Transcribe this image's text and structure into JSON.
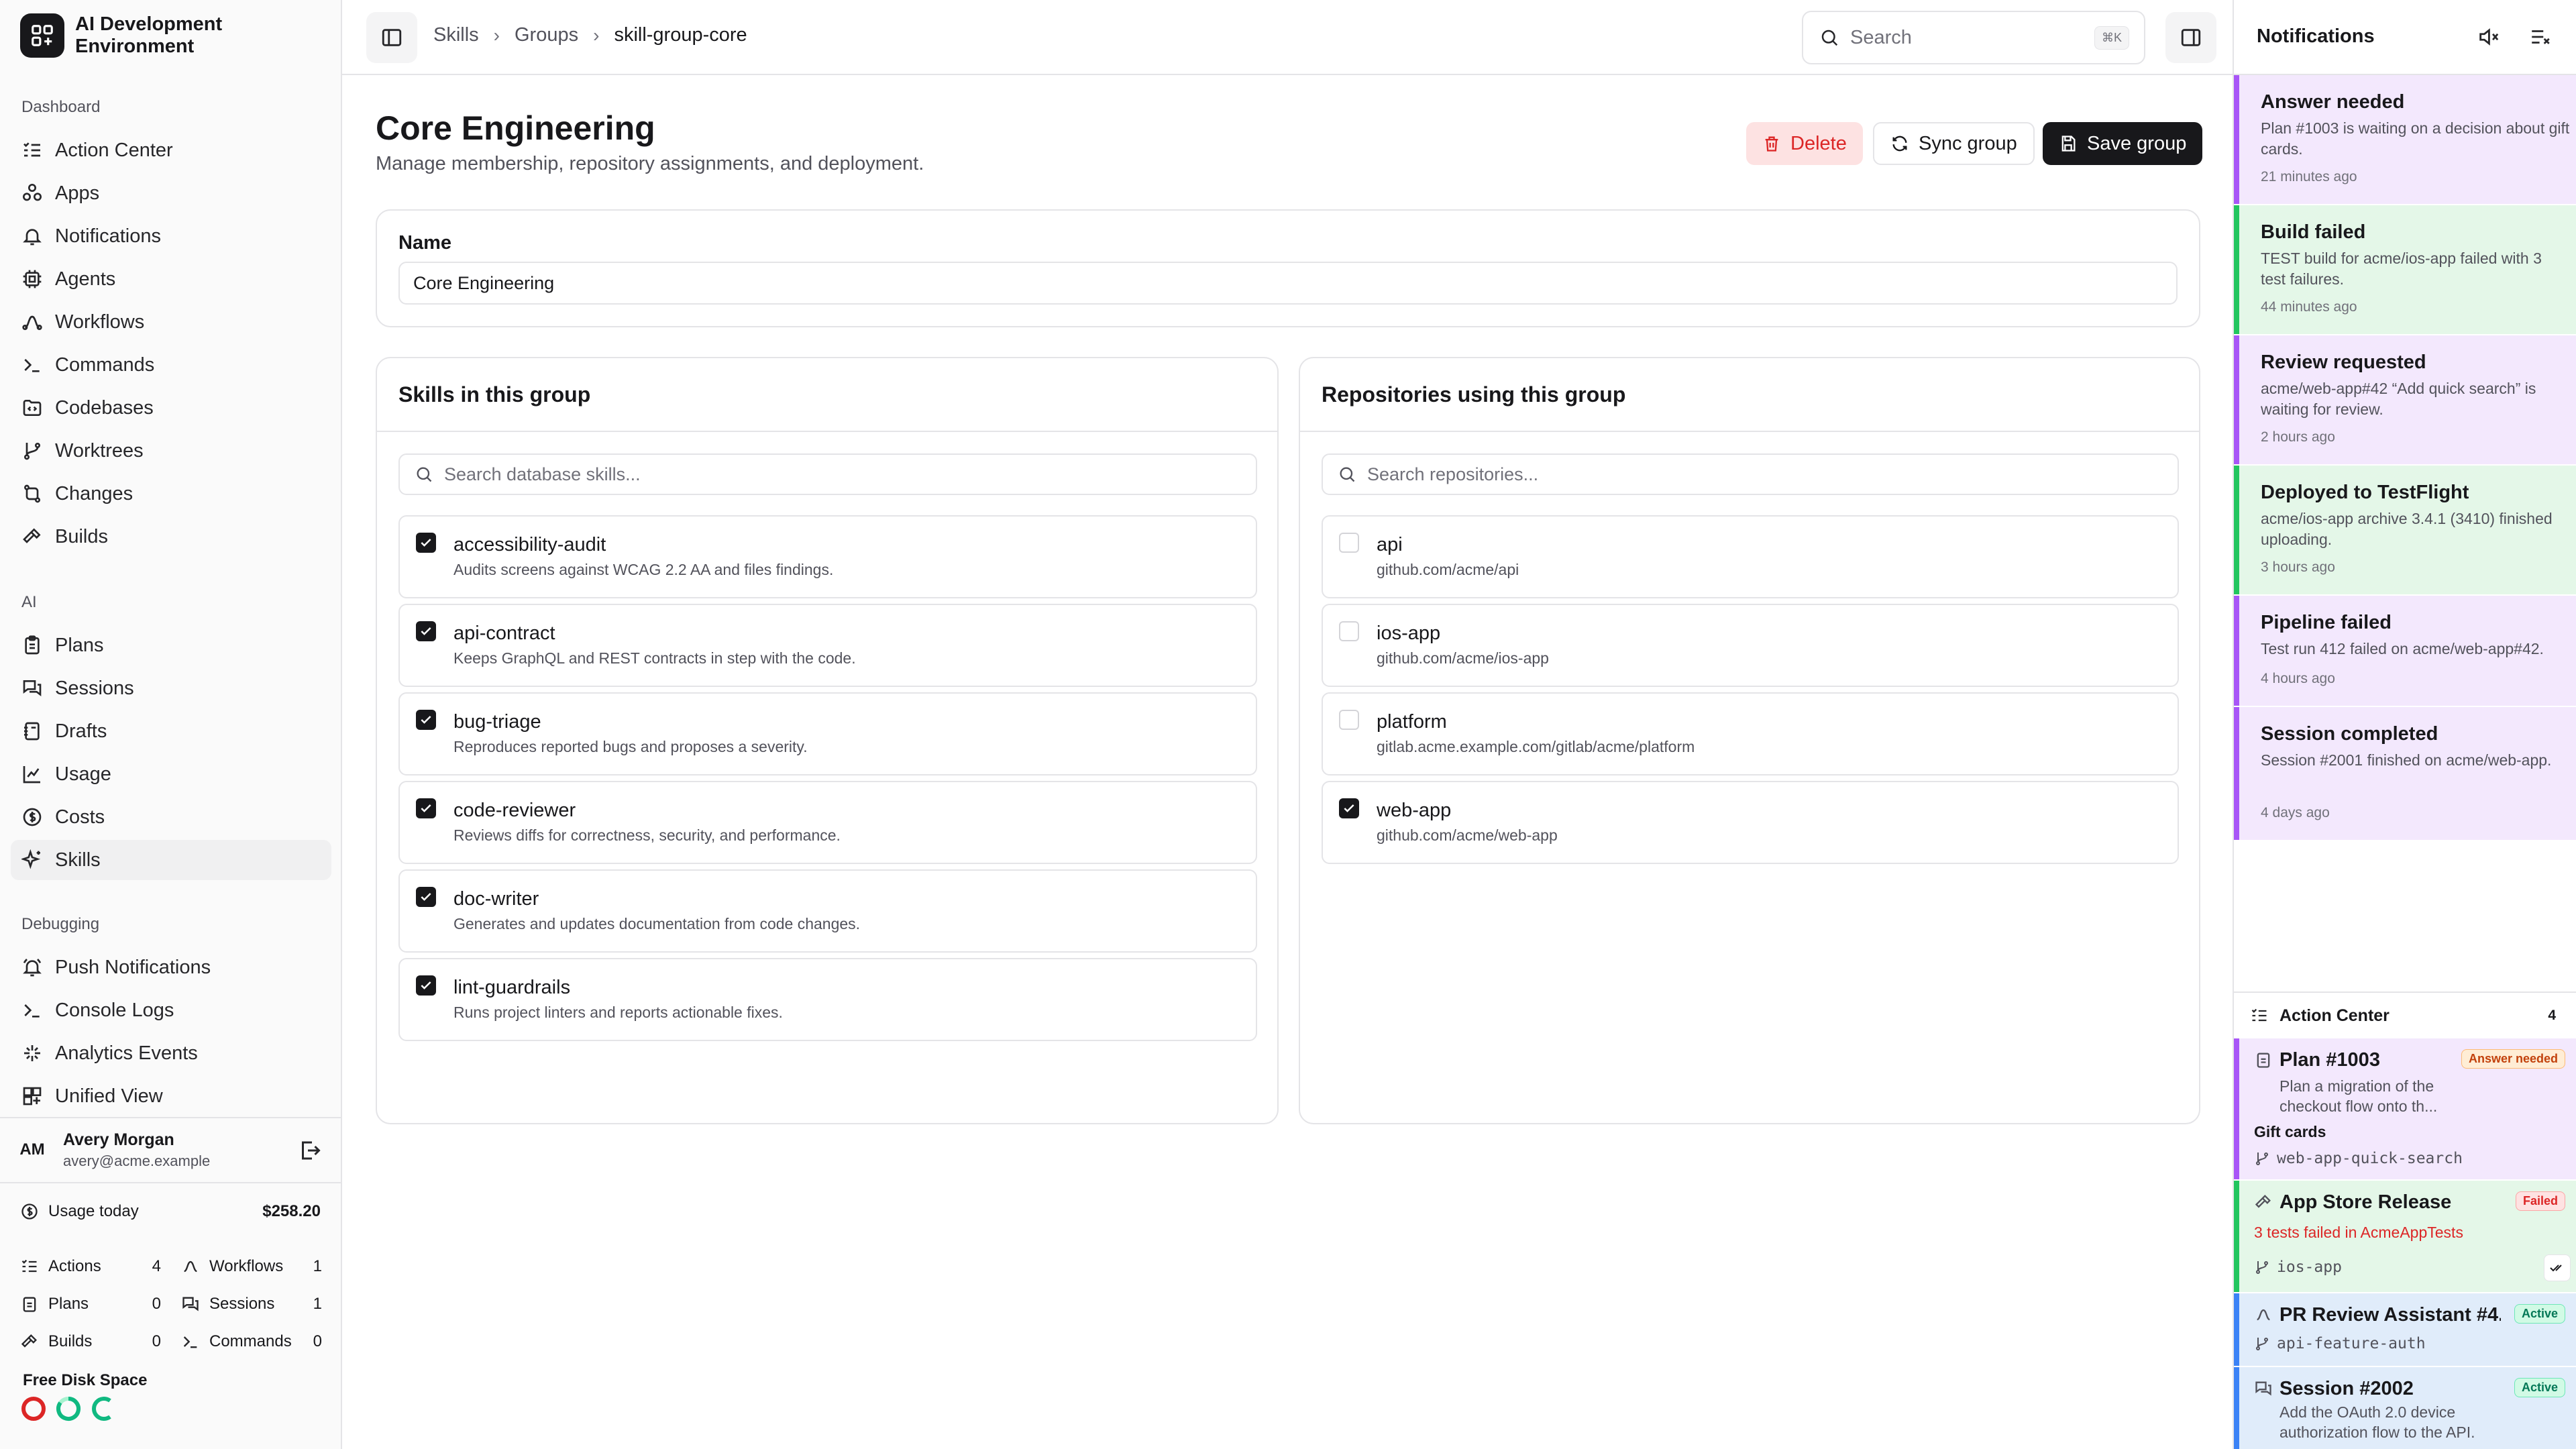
{
  "app": {
    "title": "AI Development Environment"
  },
  "sidebar": {
    "sections": {
      "dashboard": "Dashboard",
      "ai": "AI",
      "debugging": "Debugging"
    },
    "items": [
      {
        "label": "Action Center",
        "icon": "list-check-icon"
      },
      {
        "label": "Apps",
        "icon": "apps-icon"
      },
      {
        "label": "Notifications",
        "icon": "bell-icon"
      },
      {
        "label": "Agents",
        "icon": "cpu-icon"
      },
      {
        "label": "Workflows",
        "icon": "workflow-icon"
      },
      {
        "label": "Commands",
        "icon": "terminal-icon"
      },
      {
        "label": "Codebases",
        "icon": "folder-code-icon"
      },
      {
        "label": "Worktrees",
        "icon": "git-branch-icon"
      },
      {
        "label": "Changes",
        "icon": "git-compare-icon"
      },
      {
        "label": "Builds",
        "icon": "hammer-icon"
      },
      {
        "label": "Plans",
        "icon": "clipboard-icon"
      },
      {
        "label": "Sessions",
        "icon": "chat-icon"
      },
      {
        "label": "Drafts",
        "icon": "notebook-icon"
      },
      {
        "label": "Usage",
        "icon": "chart-icon"
      },
      {
        "label": "Costs",
        "icon": "dollar-icon"
      },
      {
        "label": "Skills",
        "icon": "sparkles-icon"
      },
      {
        "label": "Push Notifications",
        "icon": "bell-ring-icon"
      },
      {
        "label": "Console Logs",
        "icon": "terminal-icon"
      },
      {
        "label": "Analytics Events",
        "icon": "sparkle-icon"
      },
      {
        "label": "Unified View",
        "icon": "layout-grid-icon"
      }
    ],
    "user": {
      "initials": "AM",
      "name": "Avery Morgan",
      "email": "avery@acme.example"
    },
    "usage": {
      "label": "Usage today",
      "value": "$258.20",
      "stats": [
        {
          "label": "Actions",
          "value": "4"
        },
        {
          "label": "Workflows",
          "value": "1"
        },
        {
          "label": "Plans",
          "value": "0"
        },
        {
          "label": "Sessions",
          "value": "1"
        },
        {
          "label": "Builds",
          "value": "0"
        },
        {
          "label": "Commands",
          "value": "0"
        }
      ]
    },
    "disk": {
      "label": "Free Disk Space"
    }
  },
  "topbar": {
    "breadcrumbs": [
      "Skills",
      "Groups",
      "skill-group-core"
    ],
    "search_placeholder": "Search",
    "search_shortcut": "⌘K"
  },
  "main": {
    "title": "Core Engineering",
    "subtitle": "Manage membership, repository assignments, and deployment.",
    "actions": {
      "delete": "Delete",
      "sync": "Sync group",
      "save": "Save group"
    },
    "name_label": "Name",
    "name_value": "Core Engineering",
    "skills": {
      "title": "Skills in this group",
      "search_placeholder": "Search database skills...",
      "items": [
        {
          "name": "accessibility-audit",
          "desc": "Audits screens against WCAG 2.2 AA and files findings.",
          "checked": true
        },
        {
          "name": "api-contract",
          "desc": "Keeps GraphQL and REST contracts in step with the code.",
          "checked": true
        },
        {
          "name": "bug-triage",
          "desc": "Reproduces reported bugs and proposes a severity.",
          "checked": true
        },
        {
          "name": "code-reviewer",
          "desc": "Reviews diffs for correctness, security, and performance.",
          "checked": true
        },
        {
          "name": "doc-writer",
          "desc": "Generates and updates documentation from code changes.",
          "checked": true
        },
        {
          "name": "lint-guardrails",
          "desc": "Runs project linters and reports actionable fixes.",
          "checked": true
        }
      ]
    },
    "repos": {
      "title": "Repositories using this group",
      "search_placeholder": "Search repositories...",
      "items": [
        {
          "name": "api",
          "desc": "github.com/acme/api",
          "checked": false
        },
        {
          "name": "ios-app",
          "desc": "github.com/acme/ios-app",
          "checked": false
        },
        {
          "name": "platform",
          "desc": "gitlab.acme.example.com/gitlab/acme/platform",
          "checked": false
        },
        {
          "name": "web-app",
          "desc": "github.com/acme/web-app",
          "checked": true
        }
      ]
    }
  },
  "notifications": {
    "title": "Notifications",
    "items": [
      {
        "title": "Answer needed",
        "desc": "Plan #1003 is waiting on a decision about gift cards.",
        "time": "21 minutes ago",
        "kind": "purple"
      },
      {
        "title": "Build failed",
        "desc": "TEST build for acme/ios-app failed with 3 test failures.",
        "time": "44 minutes ago",
        "kind": "green"
      },
      {
        "title": "Review requested",
        "desc": "acme/web-app#42 “Add quick search” is waiting for review.",
        "time": "2 hours ago",
        "kind": "purple"
      },
      {
        "title": "Deployed to TestFlight",
        "desc": "acme/ios-app archive 3.4.1 (3410) finished uploading.",
        "time": "3 hours ago",
        "kind": "green"
      },
      {
        "title": "Pipeline failed",
        "desc": "Test run 412 failed on acme/web-app#42.",
        "time": "4 hours ago",
        "kind": "purple"
      },
      {
        "title": "Session completed",
        "desc": "Session #2001 finished on acme/web-app.",
        "time": "4 days ago",
        "kind": "purple"
      }
    ]
  },
  "action_center": {
    "title": "Action Center",
    "count": "4",
    "items": [
      {
        "title": "Plan #1003",
        "badge": "Answer needed",
        "desc": "Plan a migration of the checkout flow onto th...",
        "tag": "Gift cards",
        "branch": "web-app-quick-search"
      },
      {
        "title": "App Store Release",
        "badge": "Failed",
        "error": "3 tests failed in AcmeAppTests",
        "branch": "ios-app"
      },
      {
        "title": "PR Review Assistant #4...",
        "badge": "Active",
        "branch": "api-feature-auth"
      },
      {
        "title": "Session #2002",
        "badge": "Active",
        "desc": "Add the OAuth 2.0 device authorization flow to the API."
      }
    ]
  }
}
